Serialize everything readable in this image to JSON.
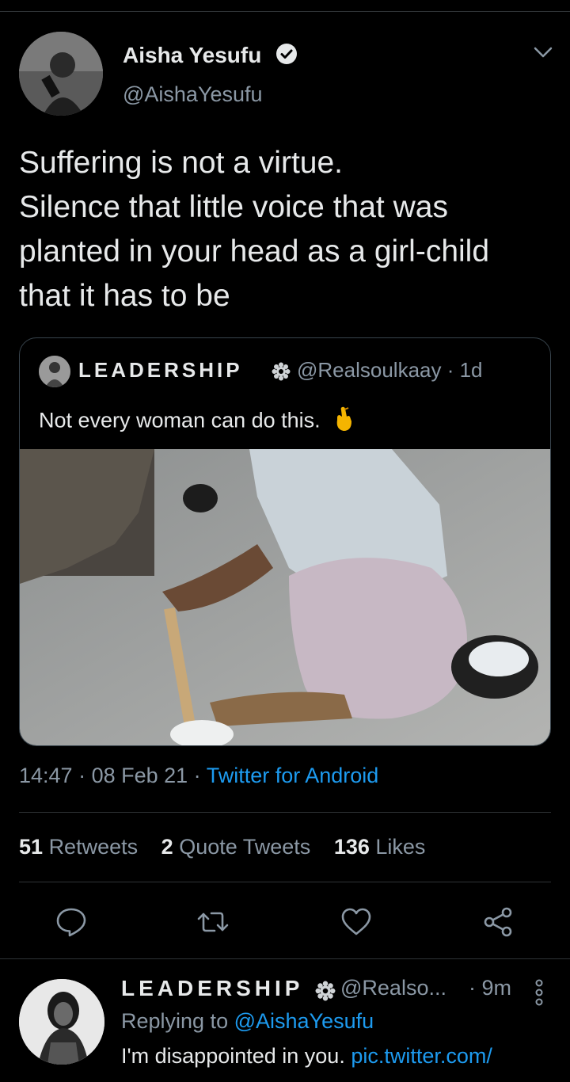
{
  "tweet": {
    "author_name": "Aisha Yesufu",
    "author_handle": "@AishaYesufu",
    "text_lines": [
      "Suffering is not a virtue.",
      "Silence that little voice that was",
      "planted in your head as a girl-child",
      "that it has to be"
    ],
    "quote": {
      "name": "LEADERSHIP",
      "handle": "@Realsoulkaay",
      "time": "· 1d",
      "text": "Not every woman can do this."
    },
    "time": "14:47",
    "date": "· 08 Feb 21 ·",
    "source": "Twitter for Android",
    "stats": {
      "retweets_count": "51",
      "retweets_label": "Retweets",
      "quotes_count": "2",
      "quotes_label": "Quote Tweets",
      "likes_count": "136",
      "likes_label": "Likes"
    }
  },
  "reply": {
    "name": "LEADERSHIP",
    "handle": "@Realso...",
    "time": "· 9m",
    "replying_prefix": "Replying to",
    "replying_handle": "@AishaYesufu",
    "text": "I'm disappointed in you.",
    "link": "pic.twitter.com/"
  },
  "icons": {
    "verified": "verified-badge-icon",
    "caret": "chevron-down-icon",
    "reply": "reply-icon",
    "retweet": "retweet-icon",
    "like": "heart-icon",
    "share": "share-icon",
    "more": "more-vertical-icon"
  },
  "colors": {
    "background": "#000000",
    "text": "#e7e9ea",
    "secondary": "#8b98a5",
    "accent": "#1d9bf0",
    "divider": "#2f3336"
  }
}
